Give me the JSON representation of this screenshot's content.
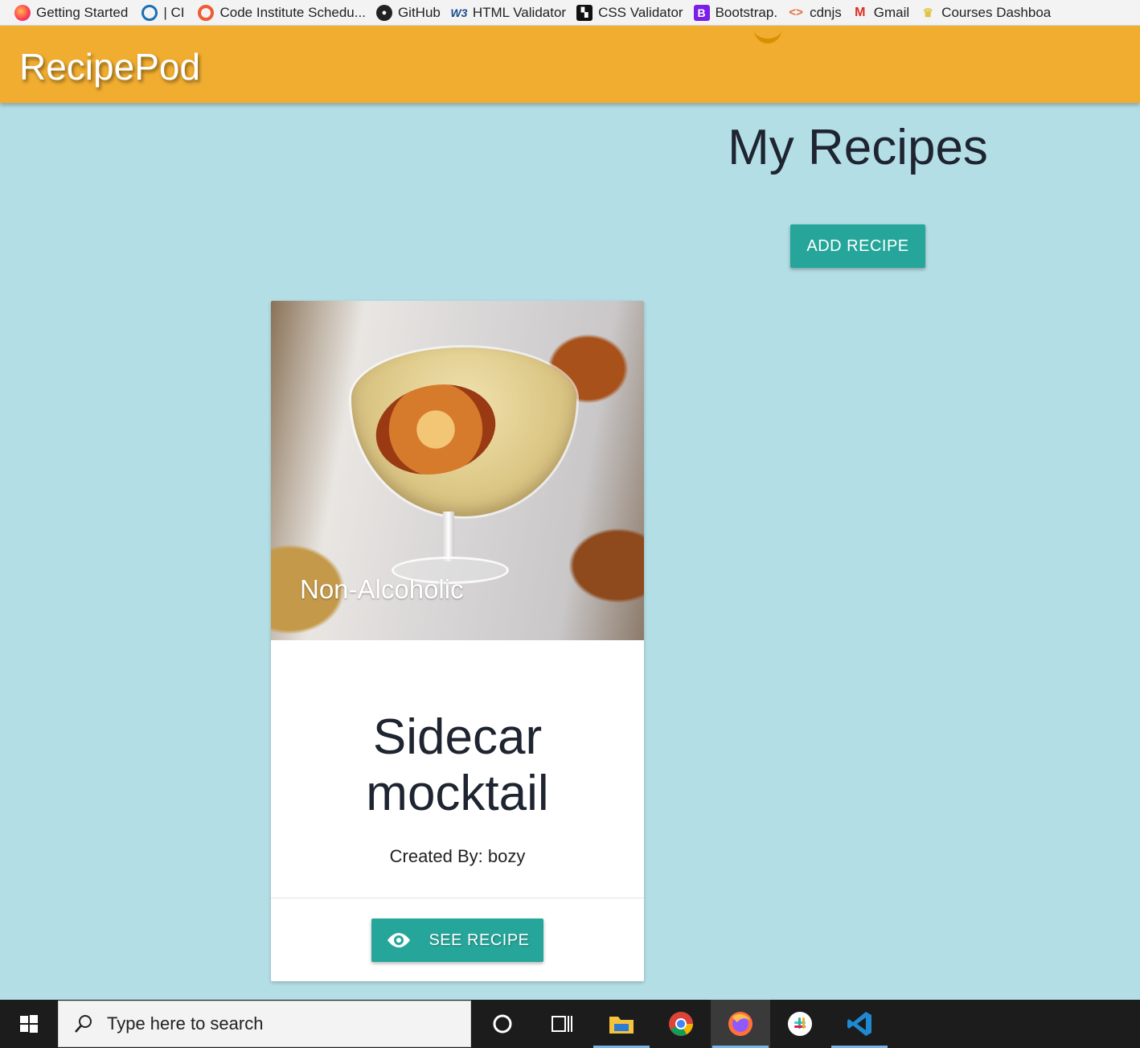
{
  "bookmarks": [
    {
      "label": "Getting Started",
      "icon": "firefox-icon"
    },
    {
      "label": "| CI",
      "icon": "ring-icon"
    },
    {
      "label": "Code Institute Schedu...",
      "icon": "code-institute-icon"
    },
    {
      "label": "GitHub",
      "icon": "github-icon"
    },
    {
      "label": "HTML Validator",
      "icon": "w3c-icon"
    },
    {
      "label": "CSS Validator",
      "icon": "css-validator-icon"
    },
    {
      "label": "Bootstrap.",
      "icon": "bootstrap-icon"
    },
    {
      "label": "cdnjs",
      "icon": "cdnjs-icon"
    },
    {
      "label": "Gmail",
      "icon": "gmail-icon"
    },
    {
      "label": "Courses Dashboa",
      "icon": "crown-icon"
    }
  ],
  "navbar": {
    "brand": "RecipePod",
    "color": "#f0ad30"
  },
  "main": {
    "title": "My Recipes",
    "add_button": "ADD RECIPE",
    "accent_color": "#26a69a",
    "background": "#b3dee5"
  },
  "recipes": [
    {
      "category": "Non-Alcoholic",
      "title_line1": "Sidecar",
      "title_line2": "mocktail",
      "author": "Created By: bozy",
      "action": "SEE RECIPE",
      "action_icon": "eye-icon"
    }
  ],
  "taskbar": {
    "search_placeholder": "Type here to search",
    "apps": [
      "cortana-icon",
      "task-view-icon",
      "file-explorer-icon",
      "chrome-icon",
      "firefox-icon",
      "slack-icon",
      "vscode-icon"
    ]
  }
}
